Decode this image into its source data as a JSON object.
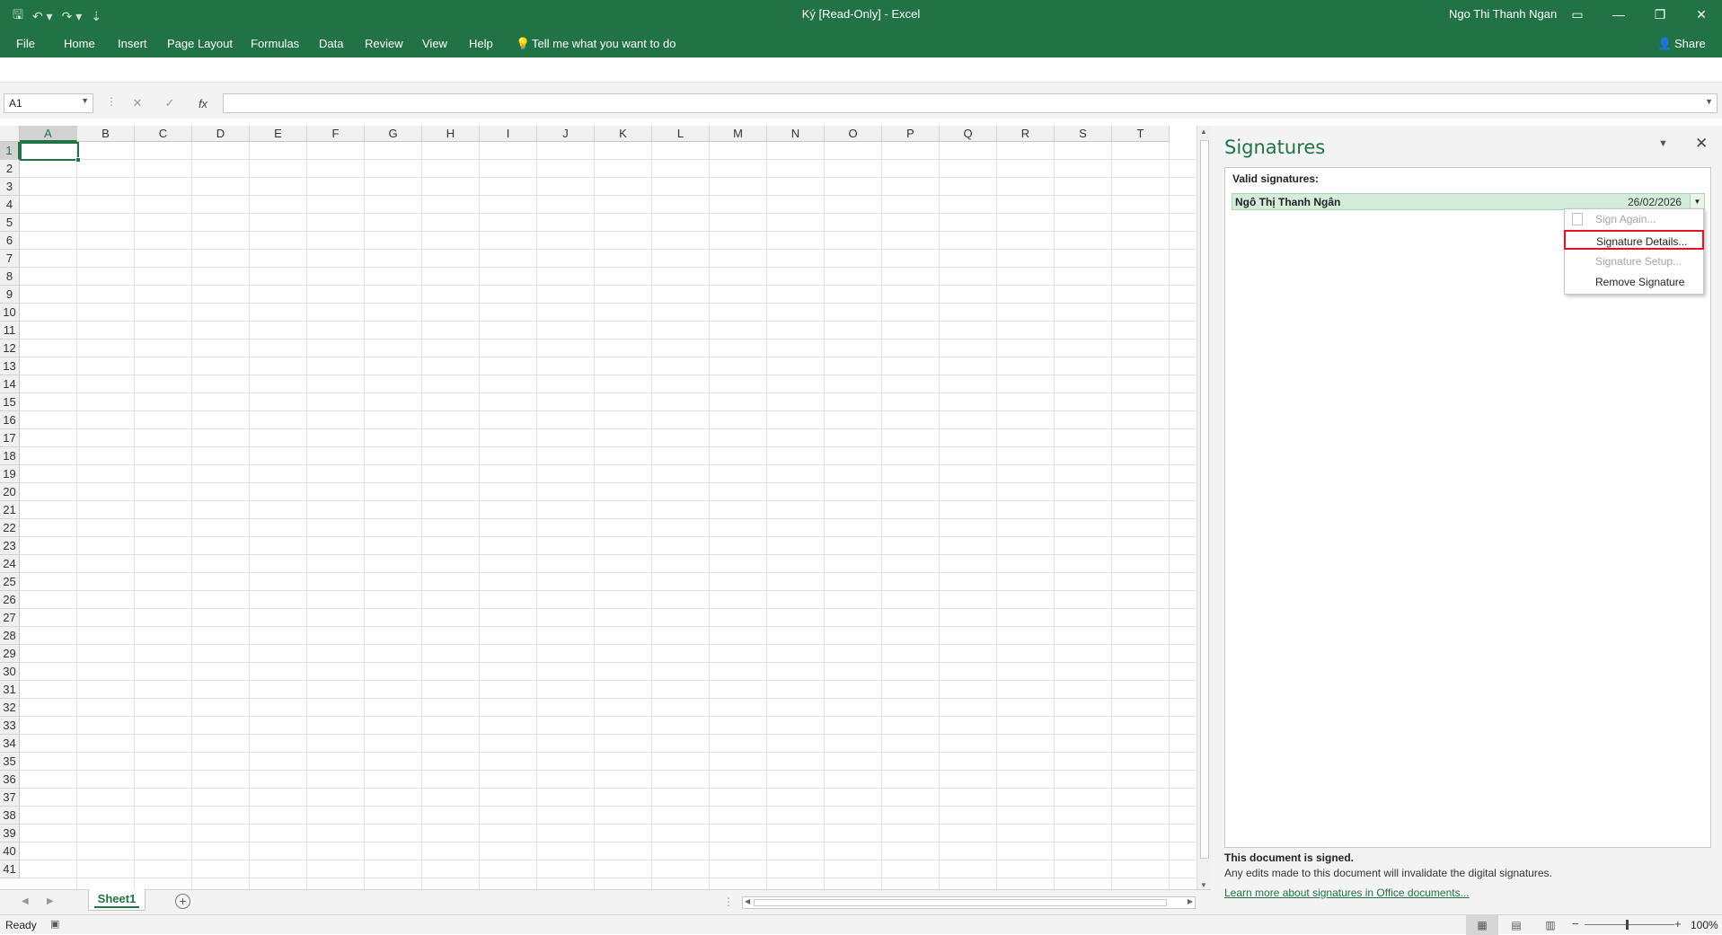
{
  "titlebar": {
    "title": "Ký  [Read-Only]  -  Excel",
    "user": "Ngo Thi Thanh Ngan"
  },
  "ribbon": {
    "tabs": [
      "File",
      "Home",
      "Insert",
      "Page Layout",
      "Formulas",
      "Data",
      "Review",
      "View",
      "Help"
    ],
    "tell_me": "Tell me what you want to do",
    "share": "Share"
  },
  "formula_bar": {
    "name_box": "A1",
    "fx": "fx",
    "value": ""
  },
  "grid": {
    "columns": [
      "A",
      "B",
      "C",
      "D",
      "E",
      "F",
      "G",
      "H",
      "I",
      "J",
      "K",
      "L",
      "M",
      "N",
      "O",
      "P",
      "Q",
      "R",
      "S",
      "T"
    ],
    "rows": [
      "1",
      "2",
      "3",
      "4",
      "5",
      "6",
      "7",
      "8",
      "9",
      "10",
      "11",
      "12",
      "13",
      "14",
      "15",
      "16",
      "17",
      "18",
      "19",
      "20",
      "21",
      "22",
      "23",
      "24",
      "25",
      "26",
      "27",
      "28",
      "29",
      "30",
      "31",
      "32",
      "33",
      "34",
      "35",
      "36",
      "37",
      "38",
      "39",
      "40",
      "41"
    ],
    "active_cell": "A1"
  },
  "sheets": {
    "tabs": [
      "Sheet1"
    ],
    "active": "Sheet1"
  },
  "status": {
    "ready": "Ready",
    "zoom": "100%"
  },
  "signatures_pane": {
    "title": "Signatures",
    "section_header": "Valid signatures:",
    "signer_name": "Ngô Thị Thanh Ngân",
    "signed_date": "26/02/2026",
    "menu": {
      "sign_again": "Sign Again...",
      "signature_details": "Signature Details...",
      "signature_setup": "Signature Setup...",
      "remove_signature": "Remove Signature"
    },
    "footer_bold": "This document is signed.",
    "footer_text": "Any edits made to this document will invalidate the digital signatures.",
    "footer_link": "Learn more about signatures in Office documents..."
  },
  "colors": {
    "brand": "#217346",
    "valid_signature_bg": "#d4edda",
    "highlight_border": "#e81123"
  }
}
